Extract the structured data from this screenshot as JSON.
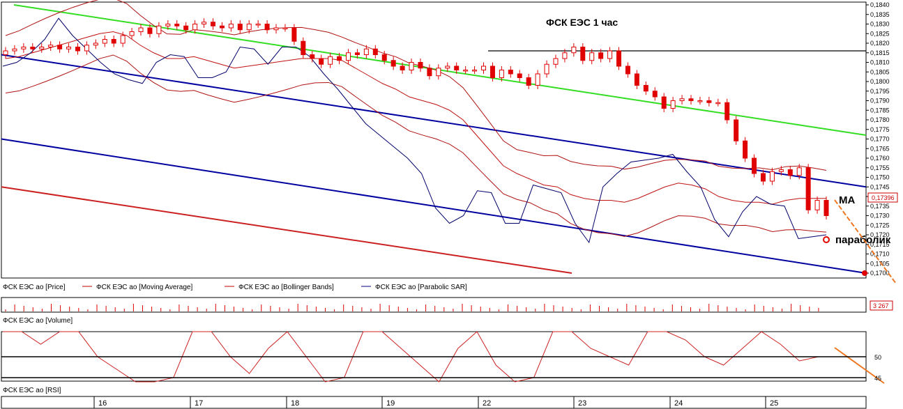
{
  "title": "ФСК ЕЭС  1 час",
  "annotations": {
    "ma": "МА",
    "sar": "параболик"
  },
  "legends": {
    "price": [
      {
        "text": "ФСК ЕЭС ао [Price]",
        "color": "#ff0000"
      },
      {
        "text": "ФСК ЕЭС ао [Moving Average]",
        "color": "#c00000"
      },
      {
        "text": "ФСК ЕЭС ао [Bollinger Bands]",
        "color": "#c00000"
      },
      {
        "text": "ФСК ЕЭС ао [Parabolic SAR]",
        "color": "#000080"
      }
    ],
    "volume": "ФСК ЕЭС ао [Volume]",
    "rsi": "ФСК ЕЭС ао [RSI]"
  },
  "price_badge": "0,17396",
  "volume_badge": "3 267",
  "colors": {
    "candle": "#e00000",
    "ma": "#c01010",
    "bb": "#b01010",
    "sar": "#00006a",
    "green": "#33dd22",
    "blue": "#0000a0",
    "red": "#cc2020",
    "orange": "#ee7722"
  },
  "chart_data": {
    "type": "candlestick",
    "y_axis": {
      "min": 0.17,
      "max": 0.184,
      "ticks": [
        "0,1700",
        "0,1705",
        "0,1710",
        "0,1715",
        "0,1720",
        "0,1725",
        "0,1730",
        "0,1735",
        "0,1740",
        "0,1745",
        "0,1750",
        "0,1755",
        "0,1760",
        "0,1765",
        "0,1770",
        "0,1775",
        "0,1780",
        "0,1785",
        "0,1790",
        "0,1795",
        "0,1800",
        "0,1805",
        "0,1810",
        "0,1815",
        "0,1820",
        "0,1825",
        "0,1830",
        "0,1835",
        "0,1840"
      ]
    },
    "x_axis": {
      "labels": [
        "16",
        "17",
        "18",
        "19",
        "22",
        "23",
        "24",
        "25"
      ],
      "bars_per_day": 10,
      "total_bars": 92
    },
    "close": [
      0.1816,
      0.1817,
      0.1818,
      0.1817,
      0.1818,
      0.1819,
      0.1817,
      0.1818,
      0.1816,
      0.1819,
      0.182,
      0.1822,
      0.182,
      0.1824,
      0.1826,
      0.1828,
      0.1825,
      0.1829,
      0.183,
      0.1829,
      0.1827,
      0.183,
      0.1831,
      0.1829,
      0.1828,
      0.183,
      0.1827,
      0.183,
      0.183,
      0.1827,
      0.1828,
      0.1828,
      0.1821,
      0.1814,
      0.1812,
      0.1809,
      0.1813,
      0.1811,
      0.1815,
      0.1814,
      0.1817,
      0.1814,
      0.1811,
      0.1808,
      0.1806,
      0.181,
      0.1807,
      0.1803,
      0.1807,
      0.1808,
      0.1806,
      0.1806,
      0.1806,
      0.1808,
      0.1802,
      0.1806,
      0.1804,
      0.1802,
      0.1798,
      0.1804,
      0.1809,
      0.1812,
      0.1815,
      0.1818,
      0.1811,
      0.1815,
      0.1812,
      0.1816,
      0.1808,
      0.1804,
      0.1798,
      0.1795,
      0.1792,
      0.1786,
      0.179,
      0.1791,
      0.179,
      0.179,
      0.1789,
      0.1789,
      0.178,
      0.1769,
      0.176,
      0.1752,
      0.1748,
      0.1753,
      0.1754,
      0.1751,
      0.1755,
      0.1733,
      0.1738,
      0.173
    ],
    "ma": [
      0.1812,
      0.1813,
      0.1815,
      0.1817,
      0.1819,
      0.1821,
      0.1823,
      0.1825,
      0.1826,
      0.1824,
      0.1819,
      0.1815,
      0.1812,
      0.1812,
      0.1813,
      0.1811,
      0.1809,
      0.1807,
      0.1808,
      0.1809,
      0.181,
      0.1811,
      0.1812,
      0.1812,
      0.1812,
      0.1811,
      0.1807,
      0.1803,
      0.1799,
      0.1796,
      0.1792,
      0.179,
      0.1788,
      0.1785,
      0.178,
      0.1772,
      0.1764,
      0.1756,
      0.1752,
      0.1749,
      0.1746,
      0.1745,
      0.1741,
      0.1739,
      0.1738,
      0.1738,
      0.1737,
      0.1739,
      0.1742,
      0.1745,
      0.1747,
      0.1746,
      0.1744,
      0.174,
      0.1738,
      0.1737,
      0.1737,
      0.1736,
      0.1738,
      0.1739,
      0.1739,
      0.1739
    ],
    "sar": [
      0.1808,
      0.181,
      0.1815,
      0.1822,
      0.1833,
      0.1824,
      0.1817,
      0.181,
      0.1804,
      0.1801,
      0.1799,
      0.181,
      0.1814,
      0.1813,
      0.1802,
      0.1802,
      0.1805,
      0.1818,
      0.1817,
      0.1809,
      0.1818,
      0.1818,
      0.1813,
      0.1804,
      0.1796,
      0.1787,
      0.1778,
      0.1772,
      0.1766,
      0.176,
      0.1752,
      0.1734,
      0.1726,
      0.173,
      0.1743,
      0.1742,
      0.1726,
      0.1726,
      0.1746,
      0.1744,
      0.1742,
      0.1726,
      0.1716,
      0.1745,
      0.1752,
      0.1758,
      0.1759,
      0.176,
      0.1762,
      0.1753,
      0.1745,
      0.1728,
      0.1719,
      0.1732,
      0.174,
      0.1736,
      0.1735,
      0.1718,
      0.1719,
      0.172
    ],
    "rsi_levels": [
      50,
      45
    ],
    "lines": [
      {
        "name": "green",
        "from": 0.184,
        "to": 0.1772
      },
      {
        "name": "horizontal",
        "from": 0.1816,
        "to": 0.1816
      },
      {
        "name": "blue-upper",
        "from": 0.1814,
        "to": 0.1745
      },
      {
        "name": "blue-lower",
        "from": 0.177,
        "to": 0.17
      },
      {
        "name": "red",
        "from": 0.1745,
        "to": 0.17
      }
    ]
  }
}
